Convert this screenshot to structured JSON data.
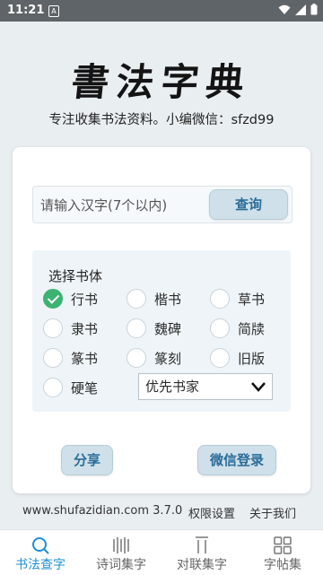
{
  "status_bar": {
    "time": "11:21",
    "notification_icon": "A"
  },
  "header": {
    "logo_text": "書法字典",
    "subtitle": "专注收集书法资料。小编微信：sfzd99"
  },
  "search": {
    "placeholder": "请输入汉字(7个以内)",
    "value": "",
    "button_label": "查询"
  },
  "style_panel": {
    "title": "选择书体",
    "options": [
      "行书",
      "楷书",
      "草书",
      "隶书",
      "魏碑",
      "简牍",
      "篆书",
      "篆刻",
      "旧版",
      "硬笔"
    ],
    "selected": "行书",
    "dropdown_value": "优先书家"
  },
  "actions": {
    "share_label": "分享",
    "wechat_login_label": "微信登录"
  },
  "footer": {
    "site_version": "www.shufazidian.com 3.7.0",
    "permissions": "权限设置",
    "about": "关于我们"
  },
  "nav": {
    "items": [
      {
        "label": "书法查字",
        "icon": "search-icon"
      },
      {
        "label": "诗词集字",
        "icon": "columns-icon"
      },
      {
        "label": "对联集字",
        "icon": "couplet-icon"
      },
      {
        "label": "字帖集",
        "icon": "grid-icon"
      }
    ],
    "active": "书法查字"
  },
  "colors": {
    "accent": "#1e8fd6",
    "checked": "#3cb371",
    "button_text": "#2b6d98"
  }
}
